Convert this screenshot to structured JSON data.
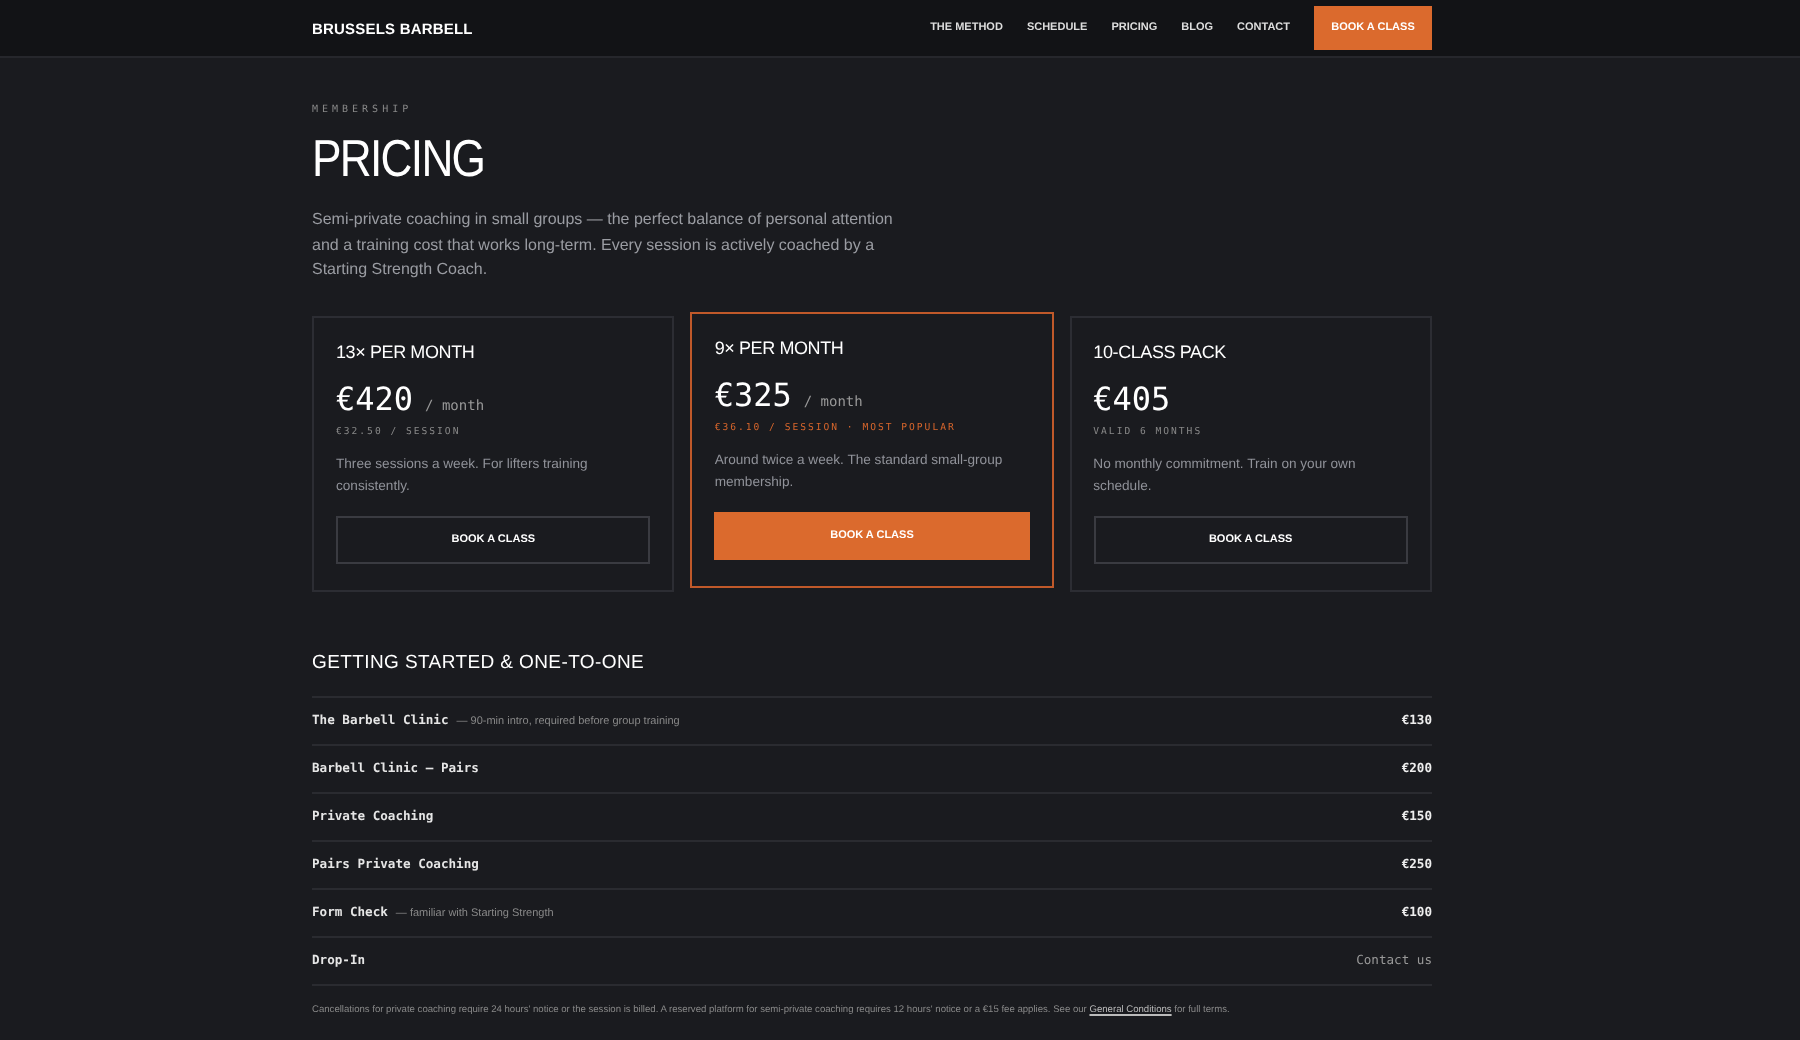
{
  "nav": {
    "brand": "BRUSSELS BARBELL",
    "links": [
      "THE METHOD",
      "SCHEDULE",
      "PRICING",
      "BLOG",
      "CONTACT"
    ],
    "cta": "BOOK A CLASS"
  },
  "header": {
    "eyebrow": "MEMBERSHIP",
    "title": "PRICING",
    "intro": "Semi-private coaching in small groups — the perfect balance of personal attention and a training cost that works long-term. Every session is actively coached by a Starting Strength Coach."
  },
  "plans": [
    {
      "name": "13× PER MONTH",
      "price": "€420",
      "period": "/ month",
      "subline": "€32.50 / SESSION",
      "description": "Three sessions a week. For lifters training consistently.",
      "button": "BOOK A CLASS",
      "featured": false
    },
    {
      "name": "9× PER MONTH",
      "price": "€325",
      "period": "/ month",
      "subline": "€36.10 / SESSION · MOST POPULAR",
      "description": "Around twice a week. The standard small-group membership.",
      "button": "BOOK A CLASS",
      "featured": true
    },
    {
      "name": "10-CLASS PACK",
      "price": "€405",
      "subline": "VALID 6 MONTHS",
      "description": "No monthly commitment. Train on your own schedule.",
      "button": "BOOK A CLASS",
      "featured": false
    }
  ],
  "services": {
    "heading": "GETTING STARTED & ONE-TO-ONE",
    "rows": [
      {
        "name": "The Barbell Clinic",
        "note": "— 90-min intro, required before group training",
        "price": "€130",
        "muted": false
      },
      {
        "name": "Barbell Clinic — Pairs",
        "price": "€200",
        "muted": false
      },
      {
        "name": "Private Coaching",
        "price": "€150",
        "muted": false
      },
      {
        "name": "Pairs Private Coaching",
        "price": "€250",
        "muted": false
      },
      {
        "name": "Form Check",
        "note": "— familiar with Starting Strength",
        "price": "€100",
        "muted": false
      },
      {
        "name": "Drop-In",
        "price": "Contact us",
        "muted": true
      }
    ]
  },
  "footnote": {
    "before": "Cancellations for private coaching require 24 hours' notice or the session is billed. A reserved platform for semi-private coaching requires 12 hours' notice or a €15 fee applies. See our",
    "link": "General Conditions",
    "after": "for full terms."
  }
}
